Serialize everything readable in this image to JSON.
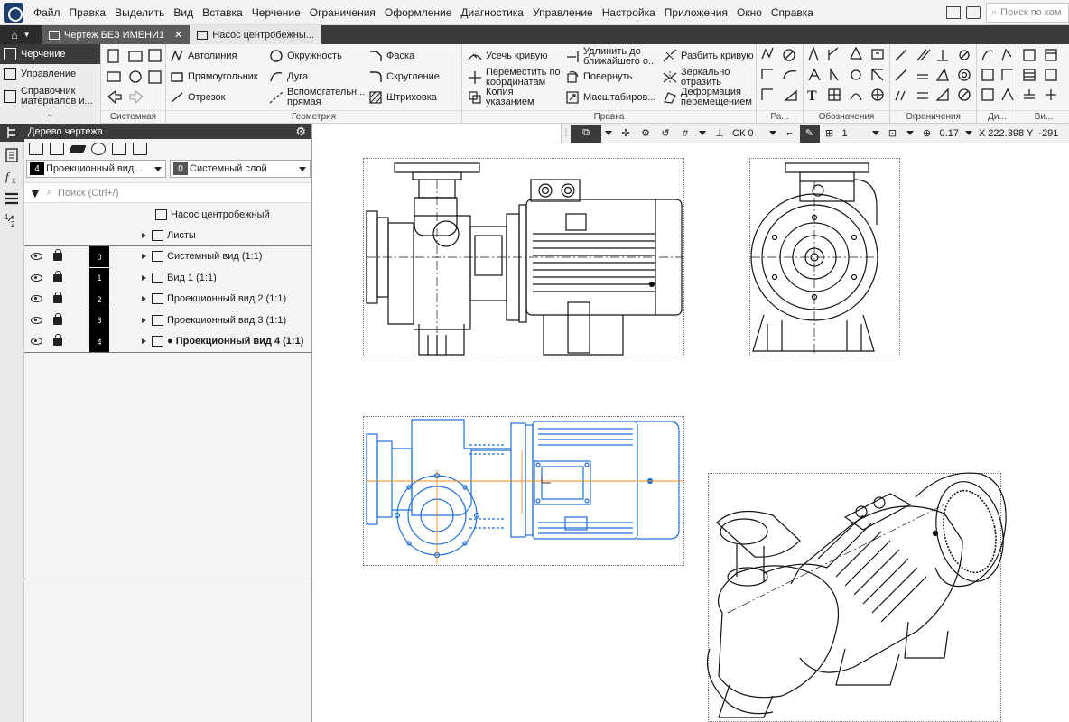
{
  "menubar": {
    "items": [
      "Файл",
      "Правка",
      "Выделить",
      "Вид",
      "Вставка",
      "Черчение",
      "Ограничения",
      "Оформление",
      "Диагностика",
      "Управление",
      "Настройка",
      "Приложения",
      "Окно",
      "Справка"
    ],
    "search_placeholder": "Поиск по ком"
  },
  "tabs": {
    "doc_tab_1": "Чертеж БЕЗ ИМЕНИ1",
    "doc_tab_2": "Насос центробежны..."
  },
  "ribbon": {
    "modes": [
      "Черчение",
      "Управление",
      "Справочник материалов и..."
    ],
    "system_label": "Системная",
    "geometry_label": "Геометрия",
    "edit_label": "Правка",
    "designations_label": "Обозначения",
    "constraints_label": "Ограничения",
    "ra_label": "Ра...",
    "di_label": "Ди...",
    "vi_label": "Ви...",
    "geometry_buttons": {
      "autoline": "Автолиния",
      "rectangle": "Прямоугольник",
      "segment": "Отрезок",
      "circle": "Окружность",
      "arc": "Дуга",
      "aux_line_1": "Вспомогательн...",
      "aux_line_2": "прямая",
      "chamfer": "Фаска",
      "fillet": "Скругление",
      "hatch": "Штриховка"
    },
    "edit_buttons": {
      "trim": "Усечь кривую",
      "move_1": "Переместить по",
      "move_2": "координатам",
      "copy_1": "Копия",
      "copy_2": "указанием",
      "extend_1": "Удлинить до",
      "extend_2": "ближайшего о...",
      "rotate": "Повернуть",
      "scale": "Масштабиров...",
      "split": "Разбить кривую",
      "mirror_1": "Зеркально",
      "mirror_2": "отразить",
      "deform_1": "Деформация",
      "deform_2": "перемещением"
    }
  },
  "tree": {
    "header": "Дерево чертежа",
    "view_select_num": "4",
    "view_select_label": "Проекционный вид...",
    "layer_select_num": "0",
    "layer_select_label": "Системный слой",
    "search_placeholder": "Поиск (Ctrl+/)",
    "root_label": "Насос центробежный",
    "sheets_label": "Листы",
    "views": [
      {
        "num": "0",
        "label": "Системный вид (1:1)"
      },
      {
        "num": "1",
        "label": "Вид 1 (1:1)"
      },
      {
        "num": "2",
        "label": "Проекционный вид 2 (1:1)"
      },
      {
        "num": "3",
        "label": "Проекционный вид 3 (1:1)"
      },
      {
        "num": "4",
        "label": "● Проекционный вид 4 (1:1)"
      }
    ]
  },
  "view_toolbar": {
    "cs_label": "СК 0",
    "layer_value": "1",
    "zoom_value": "0.17",
    "x_label": "X",
    "x_value": "222.398",
    "y_label": "Y",
    "y_value": "-291"
  },
  "colors": {
    "dark_panel": "#3b3b3b",
    "active_view_blue": "#1f6fd6",
    "axis_orange": "#f08a24"
  }
}
